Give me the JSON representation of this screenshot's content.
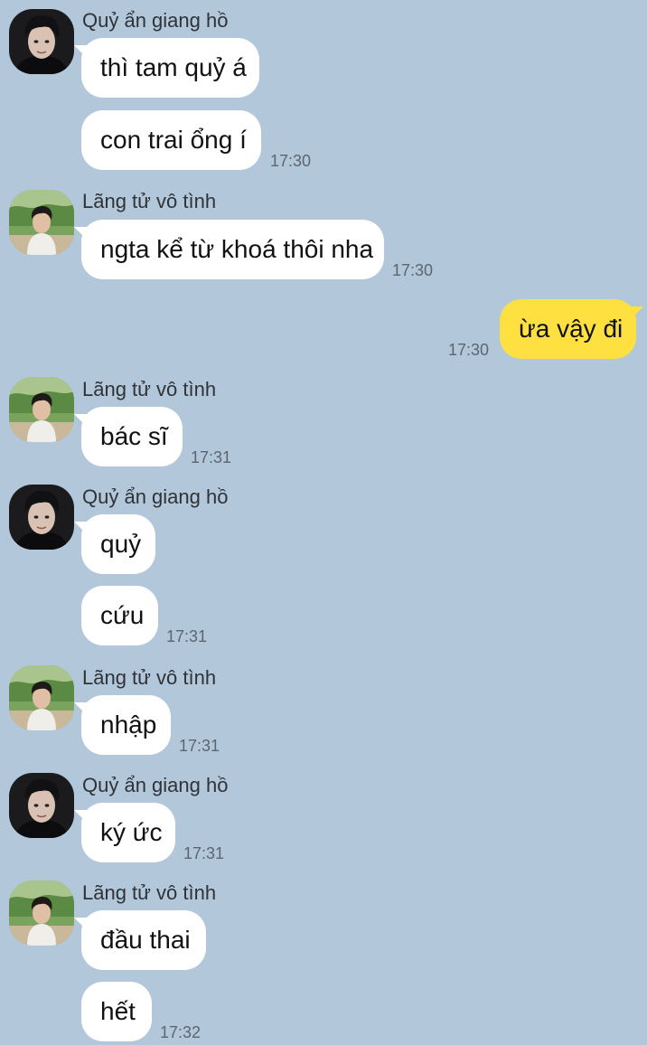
{
  "contacts": {
    "quy": {
      "name": "Quỷ ẩn giang hồ",
      "avatar_icon": "dark-haired-man-avatar-icon"
    },
    "lang": {
      "name": "Lãng tử vô tình",
      "avatar_icon": "boy-outdoors-avatar-icon"
    }
  },
  "messages": [
    {
      "text": "thì tam quỷ á"
    },
    {
      "text": "con trai ổng í",
      "time": "17:30"
    },
    {
      "text": "ngta kể từ khoá thôi nha",
      "time": "17:30"
    },
    {
      "text": "ừa vậy đi",
      "time": "17:30"
    },
    {
      "text": "bác sĩ",
      "time": "17:31"
    },
    {
      "text": "quỷ"
    },
    {
      "text": "cứu",
      "time": "17:31"
    },
    {
      "text": "nhập",
      "time": "17:31"
    },
    {
      "text": "ký ức",
      "time": "17:31"
    },
    {
      "text": "đầu thai"
    },
    {
      "text": "hết",
      "time": "17:32"
    }
  ],
  "colors": {
    "background": "#b2c7da",
    "incoming_bubble": "#ffffff",
    "outgoing_bubble": "#fee140"
  }
}
